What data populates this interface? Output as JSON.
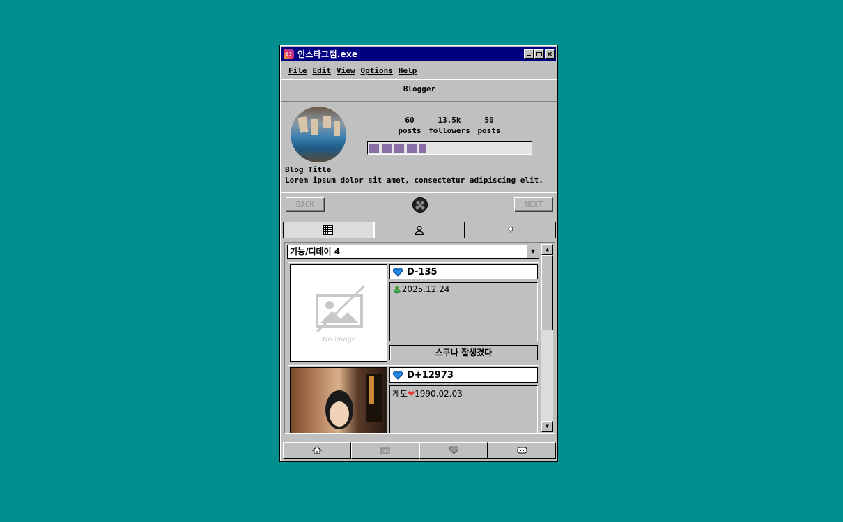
{
  "window": {
    "title": "인스타그램.exe"
  },
  "menu": [
    "File",
    "Edit",
    "View",
    "Options",
    "Help"
  ],
  "header": {
    "label": "Blogger"
  },
  "profile": {
    "stats": [
      {
        "value": "60",
        "label": "posts"
      },
      {
        "value": "13.5k",
        "label": "followers"
      },
      {
        "value": "50",
        "label": "posts"
      }
    ],
    "progress": {
      "segments_filled": 5
    },
    "blog_title": "Blog Title",
    "description": "Lorem ipsum dolor sit amet, consectetur adipiscing elit."
  },
  "nav": {
    "back": "BACK",
    "next": "NEXT"
  },
  "tabs": [
    {
      "icon": "grid-icon"
    },
    {
      "icon": "user-icon"
    },
    {
      "icon": "pin-icon"
    }
  ],
  "list": {
    "selected": "기능/디데이 4",
    "cards": [
      {
        "dday": "D-135",
        "icon_text": "🎄",
        "note": "2025.12.24",
        "caption": "스쿠나 잘생겼다",
        "image": "No image"
      },
      {
        "dday": "D+12973",
        "note_prefix": "게토",
        "icon_text": "❤",
        "note": "1990.02.03",
        "caption": ""
      }
    ]
  },
  "colors": {
    "desktop": "#008f8f",
    "titlebar": "#000080",
    "accent": "#8a6fa6",
    "heart": "#1565c0"
  },
  "bottom_nav": [
    "home-icon",
    "camera-icon",
    "heart-icon",
    "message-icon"
  ]
}
